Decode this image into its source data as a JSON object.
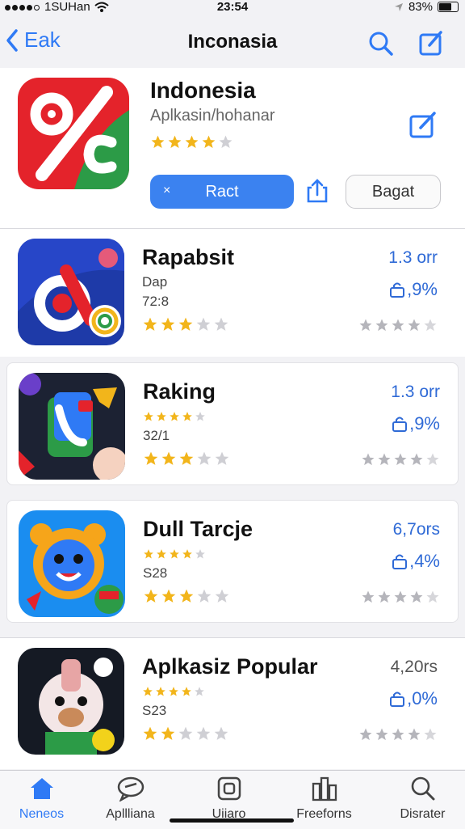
{
  "status": {
    "carrier": "1SUHan",
    "time": "23:54",
    "battery": "83%"
  },
  "nav": {
    "back_label": "Eak",
    "title": "Inconasia"
  },
  "featured": {
    "name": "Indonesia",
    "subtitle": "Aplkasin/hohanar",
    "rating": 4,
    "get_label": "Ract",
    "get_prefix": "×",
    "secondary_label": "Bagat",
    "icon_colors": [
      "#e4232b",
      "#2c9b47",
      "#ffffff"
    ]
  },
  "apps": [
    {
      "name": "Rapabsit",
      "line1": "Dap",
      "line2": "72:8",
      "rating": 3,
      "size": "1.3 orr",
      "percent": ",9%",
      "gray_rating": 4
    },
    {
      "name": "Raking",
      "line1": "",
      "line2": "32/1",
      "rating": 3,
      "size": "1.3 orr",
      "percent": ",9%",
      "gray_rating": 4,
      "mini_rating": 4
    },
    {
      "name": "Dull Tarcje",
      "line1": "",
      "line2": "S28",
      "rating": 3,
      "size": "6,7ors",
      "percent": ",4%",
      "gray_rating": 4,
      "mini_rating": 4
    },
    {
      "name": "Aplkasiz Popular",
      "line1": "",
      "line2": "S23",
      "rating": 2,
      "size": "4,20rs",
      "percent": ",0%",
      "gray_rating": 4,
      "mini_rating": 4
    }
  ],
  "tabs": [
    {
      "label": "Neneos",
      "icon": "home-icon",
      "active": true
    },
    {
      "label": "Apllliana",
      "icon": "chat-icon",
      "active": false
    },
    {
      "label": "Uiiaro",
      "icon": "square-icon",
      "active": false
    },
    {
      "label": "Freeforns",
      "icon": "stack-icon",
      "active": false
    },
    {
      "label": "Disrater",
      "icon": "search-icon",
      "active": false
    }
  ],
  "colors": {
    "accent": "#2f7af5",
    "star": "#f2b51b",
    "star_gray": "#b5b5bb"
  }
}
